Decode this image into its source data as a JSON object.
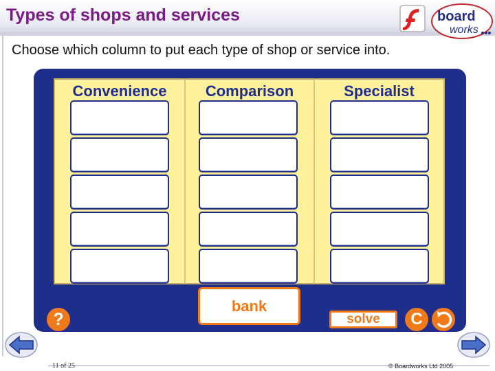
{
  "header": {
    "title": "Types of shops and services",
    "logo_line1": "board",
    "logo_line2": "works"
  },
  "instructions": "Choose which column to put each type of shop or service into.",
  "columns": [
    {
      "label": "Convenience",
      "slots": [
        "",
        "",
        "",
        "",
        ""
      ]
    },
    {
      "label": "Comparison",
      "slots": [
        "",
        "",
        "",
        "",
        ""
      ]
    },
    {
      "label": "Specialist",
      "slots": [
        "",
        "",
        "",
        "",
        ""
      ]
    }
  ],
  "controls": {
    "bank_label": "bank",
    "solve_label": "solve",
    "help_label": "?",
    "clear_label": "C"
  },
  "footer": {
    "page": "11 of 25",
    "copyright": "© Boardworks Ltd 2005"
  },
  "colors": {
    "frame": "#1f2e8a",
    "board": "#fdf19c",
    "accent": "#f07a1a",
    "title": "#7a1a86"
  },
  "icons": [
    "flash-icon",
    "boardworks-logo",
    "help-icon",
    "clear-icon",
    "reset-icon",
    "previous-slide-icon",
    "next-slide-icon"
  ]
}
